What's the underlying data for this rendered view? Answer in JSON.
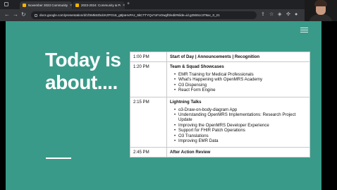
{
  "browser": {
    "tabs": [
      {
        "label": "November 2023 Community M..."
      },
      {
        "label": "2023-2024: Community & Prof..."
      }
    ],
    "url": "docs.google.com/presentation/d/1fSMk82bdcKZPO16_g8jtaHxPAz_6kCTTYQv7oFoOwgf0/edit#slide=id.g2506cc379ac_0_21"
  },
  "slide": {
    "headline_line1": "Today is",
    "headline_line2": "about....",
    "agenda": [
      {
        "time": "1:00 PM",
        "title": "Start of Day | Announcements | Recognition",
        "items": []
      },
      {
        "time": "1:20 PM",
        "title": "Team & Squad Showcases",
        "items": [
          "EMR Training for Medical Professionals",
          "What's Happening with OpenMRS Academy",
          "O3 Dispensing",
          "React Form Engine"
        ]
      },
      {
        "time": "2:15 PM",
        "title": "Lightning Talks",
        "items": [
          "o3-Draw-on-body-diagram App",
          "Understanding OpenMRS Implementations: Research Project Update",
          "Improving the OpenMRS Developer Experience",
          "Support for FHIR Patch Operations",
          "O3 Translations",
          "Improving EMR Data"
        ]
      },
      {
        "time": "2:45 PM",
        "title": "After Action Review",
        "items": []
      }
    ]
  },
  "colors": {
    "slide_background": "#3a9a89",
    "headline": "#ffffff",
    "table_background": "#ffffff"
  },
  "icons": {
    "back": "back-arrow-icon",
    "forward": "forward-arrow-icon",
    "reload": "reload-icon",
    "menu": "hamburger-menu-icon"
  }
}
